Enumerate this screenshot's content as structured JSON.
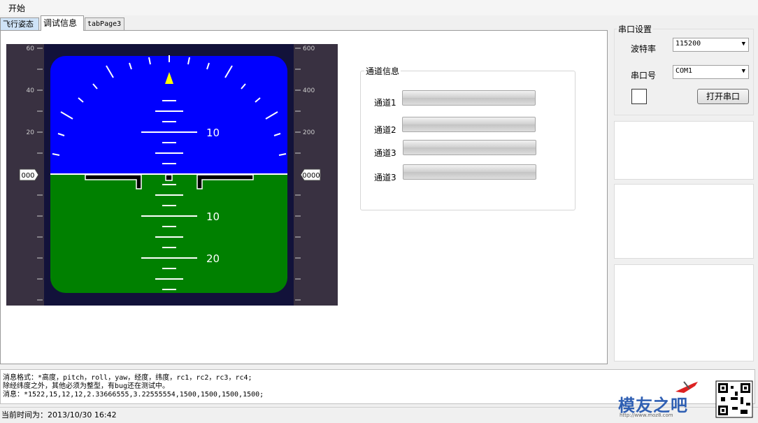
{
  "menu": {
    "start": "开始"
  },
  "tabs": {
    "flight": "飞行姿态",
    "debug": "调试信息",
    "page3": "tabPage3"
  },
  "attitude": {
    "left_scale": [
      "60",
      "40",
      "20"
    ],
    "right_scale": [
      "600",
      "400",
      "200"
    ],
    "altitude_box": "000",
    "speed_box": "0000",
    "pitch_labels": [
      "10",
      "10",
      "20"
    ],
    "colors": {
      "sky": "#0000ff",
      "ground": "#008000",
      "frame": "#393141",
      "bezel": "#12123a"
    }
  },
  "channels": {
    "title": "通道信息",
    "items": [
      {
        "label": "通道1",
        "value": 0
      },
      {
        "label": "通道2",
        "value": 0
      },
      {
        "label": "通道3",
        "value": 0
      },
      {
        "label": "通道3",
        "value": 0
      }
    ]
  },
  "serial": {
    "title": "串口设置",
    "baud_label": "波特率",
    "baud_value": "115200",
    "port_label": "串口号",
    "port_value": "COM1",
    "open_button": "打开串口"
  },
  "log": {
    "line1": "消息格式：*高度，pitch，roll，yaw，经度，纬度，rc1，rc2，rc3，rc4;",
    "line2": "除经纬度之外，其他必须为整型，有bug还在测试中。",
    "line3": "消息：*1522,15,12,12,2.33666555,3.22555554,1500,1500,1500,1500;"
  },
  "status": {
    "time": "当前时间为：2013/10/30   16:42"
  },
  "watermark": {
    "brand": "模友之吧",
    "url": "http://www.moz8.com"
  }
}
